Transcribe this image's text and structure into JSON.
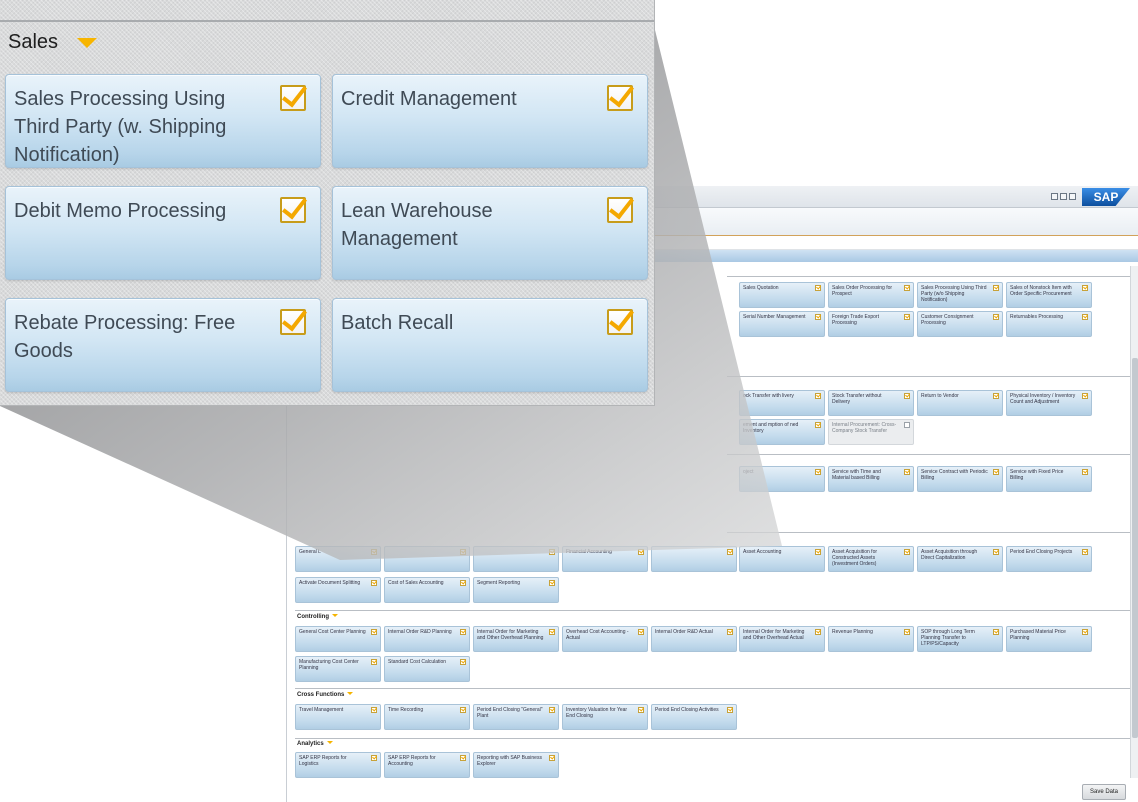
{
  "colors": {
    "accent_arrow": "#f7b500",
    "tile_top": "#e9f3fa",
    "tile_bottom": "#a9cbe3",
    "checkmark": "#f4a800",
    "zoom_panel_bg": "#d9dadb"
  },
  "zoom": {
    "section_title": "Sales",
    "tiles": [
      {
        "label": "Sales Processing Using Third Party (w. Shipping Notification)",
        "checked": true
      },
      {
        "label": "Credit Management",
        "checked": true
      },
      {
        "label": "Debit Memo Processing",
        "checked": true
      },
      {
        "label": "Lean Warehouse Management",
        "checked": true
      },
      {
        "label": "Rebate Processing: Free Goods",
        "checked": true
      },
      {
        "label": "Batch Recall",
        "checked": true
      }
    ]
  },
  "app": {
    "logo": "SAP",
    "save_label": "Save Data",
    "groups": {
      "controlling": "Controlling",
      "cross_functions": "Cross Functions",
      "analytics": "Analytics"
    },
    "tiles": {
      "sales_quotation": "Sales Quotation",
      "sales_order_prospect": "Sales Order Processing for Prospect",
      "sales_third_party": "Sales Processing Using Third Party (w/o Shipping Notification)",
      "sales_nonstock": "Sales of Nonstock Item with Order Specific Procurement",
      "serial_number": "Serial Number Management",
      "foreign_trade": "Foreign Trade Export Processing",
      "customer_consignment": "Customer Consignment Processing",
      "returnables": "Returnables Processing",
      "stock_transfer_with": "ock Transfer with livery",
      "stock_transfer_without": "Stock Transfer without Delivery",
      "return_vendor": "Return to Vendor",
      "physical_inventory": "Physical Inventory / Inventory Count and Adjustment",
      "consumption": "ement and mption of ned Inventory",
      "internal_procurement": "Internal Procurement: Cross-Company Stock Transfer",
      "project": "oject",
      "service_time_material": "Service with Time and Material based Billing",
      "service_contract": "Service Contract with Periodic Billing",
      "service_fixed": "Service with Fixed Price Billing",
      "general_ledger": "General L",
      "financial_accounting": "Financial Accounting",
      "asset_accounting": "Asset Accounting",
      "asset_constructed": "Asset Acquisition for Constructed Assets (Investment Orders)",
      "asset_direct": "Asset Acquisition through Direct Capitalization",
      "period_end_projects": "Period End Closing Projects",
      "activate_doc_split": "Activate Document Splitting",
      "cost_of_sales": "Cost of Sales Accounting",
      "segment_reporting": "Segment Reporting",
      "general_cost_center": "General Cost Center Planning",
      "internal_order_rd_planning": "Internal Order R&D Planning",
      "internal_order_marketing_planning": "Internal Order for Marketing and Other Overhead Planning",
      "overhead_cost_actual": "Overhead Cost Accounting - Actual",
      "internal_order_rd_actual": "Internal Order R&D Actual",
      "internal_order_marketing_actual": "Internal Order for Marketing and Other Overhead Actual",
      "revenue_planning": "Revenue Planning",
      "sop_long_term": "SOP through Long Term Planning Transfer to LTP/PS/Capacity",
      "purchased_material_price": "Purchased Material Price Planning",
      "manufacturing_cost_center": "Manufacturing Cost Center Planning",
      "standard_cost_calc": "Standard Cost Calculation",
      "travel_management": "Travel Management",
      "time_recording": "Time Recording",
      "period_end_general_plant": "Period End Closing \"General\" Plant",
      "inventory_valuation": "Inventory Valuation for Year End Closing",
      "period_end_activities": "Period End Closing Activities",
      "sap_erp_logistics": "SAP ERP Reports for Logistics",
      "sap_erp_accounting": "SAP ERP Reports for Accounting",
      "reporting_business_explorer": "Reporting with SAP Business Explorer"
    }
  }
}
